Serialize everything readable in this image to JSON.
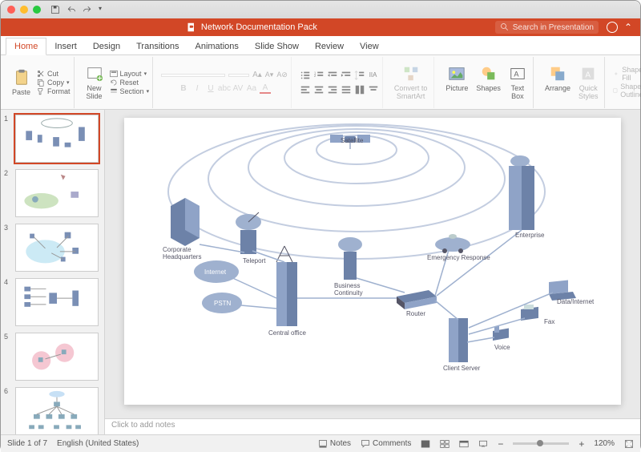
{
  "window": {
    "doc_title": "Network Documentation Pack"
  },
  "search": {
    "placeholder": "Search in Presentation"
  },
  "tabs": {
    "home": "Home",
    "insert": "Insert",
    "design": "Design",
    "transitions": "Transitions",
    "animations": "Animations",
    "slideshow": "Slide Show",
    "review": "Review",
    "view": "View"
  },
  "ribbon": {
    "paste": "Paste",
    "cut": "Cut",
    "copy": "Copy",
    "format": "Format",
    "new_slide": "New\nSlide",
    "layout": "Layout",
    "reset": "Reset",
    "section": "Section",
    "convert_smartart": "Convert to\nSmartArt",
    "picture": "Picture",
    "shapes": "Shapes",
    "textbox": "Text\nBox",
    "arrange": "Arrange",
    "quick_styles": "Quick\nStyles",
    "shape_fill": "Shape Fill",
    "shape_outline": "Shape Outline"
  },
  "thumbs": {
    "n1": "1",
    "n2": "2",
    "n3": "3",
    "n4": "4",
    "n5": "5",
    "n6": "6"
  },
  "notes": {
    "placeholder": "Click to add notes"
  },
  "status": {
    "slide": "Slide 1 of 7",
    "lang": "English (United States)",
    "notes": "Notes",
    "comments": "Comments",
    "zoom": "120%"
  },
  "diagram": {
    "satellite": "Satellite",
    "corporate_hq": "Corporate\nHeadquarters",
    "teleport": "Teleport",
    "internet": "Internet",
    "pstn": "PSTN",
    "central_office": "Central office",
    "business_continuity": "Business\nContinuity",
    "router": "Router",
    "emergency": "Emergency Response",
    "enterprise": "Enterprise",
    "client_server": "Client Server",
    "voice": "Voice",
    "fax": "Fax",
    "data_internet": "Data/Internet"
  }
}
